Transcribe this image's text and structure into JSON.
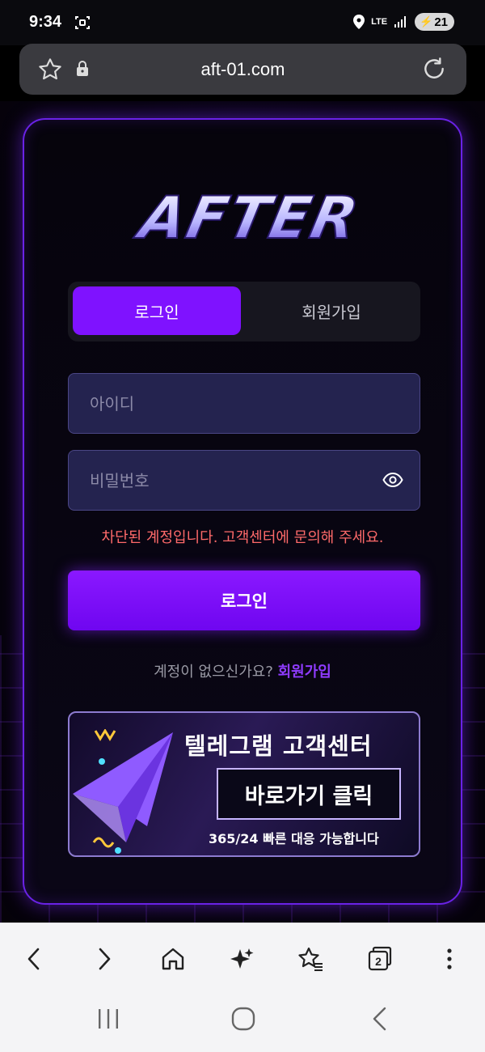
{
  "status_bar": {
    "time": "9:34",
    "network": "LTE",
    "battery": "21"
  },
  "browser": {
    "url": "aft-01.com",
    "tab_count": "2"
  },
  "brand": {
    "logo_text": "AFTER",
    "accent": "#7f12ff"
  },
  "auth_tabs": {
    "login": "로그인",
    "signup": "회원가입",
    "active": "login"
  },
  "form": {
    "id_placeholder": "아이디",
    "id_value": "",
    "password_placeholder": "비밀번호",
    "password_value": "",
    "error_message": "차단된 계정입니다. 고객센터에 문의해 주세요.",
    "submit_label": "로그인"
  },
  "signup_prompt": {
    "text": "계정이 없으신가요?",
    "link": "회원가입"
  },
  "banner": {
    "title": "텔레그램 고객센터",
    "button": "바로가기 클릭",
    "subtitle": "365/24 빠른 대응 가능합니다"
  },
  "icons": {
    "status": [
      "screenshot-icon",
      "location-icon",
      "signal-icon",
      "battery-icon"
    ],
    "url_bar": [
      "bookmark-star-icon",
      "lock-icon",
      "reload-icon"
    ],
    "bottom_nav": [
      "back-icon",
      "forward-icon",
      "home-icon",
      "sparkle-icon",
      "favorites-icon",
      "tabs-icon",
      "more-icon"
    ],
    "system_nav": [
      "recent-apps-icon",
      "home-circle-icon",
      "system-back-icon"
    ]
  }
}
